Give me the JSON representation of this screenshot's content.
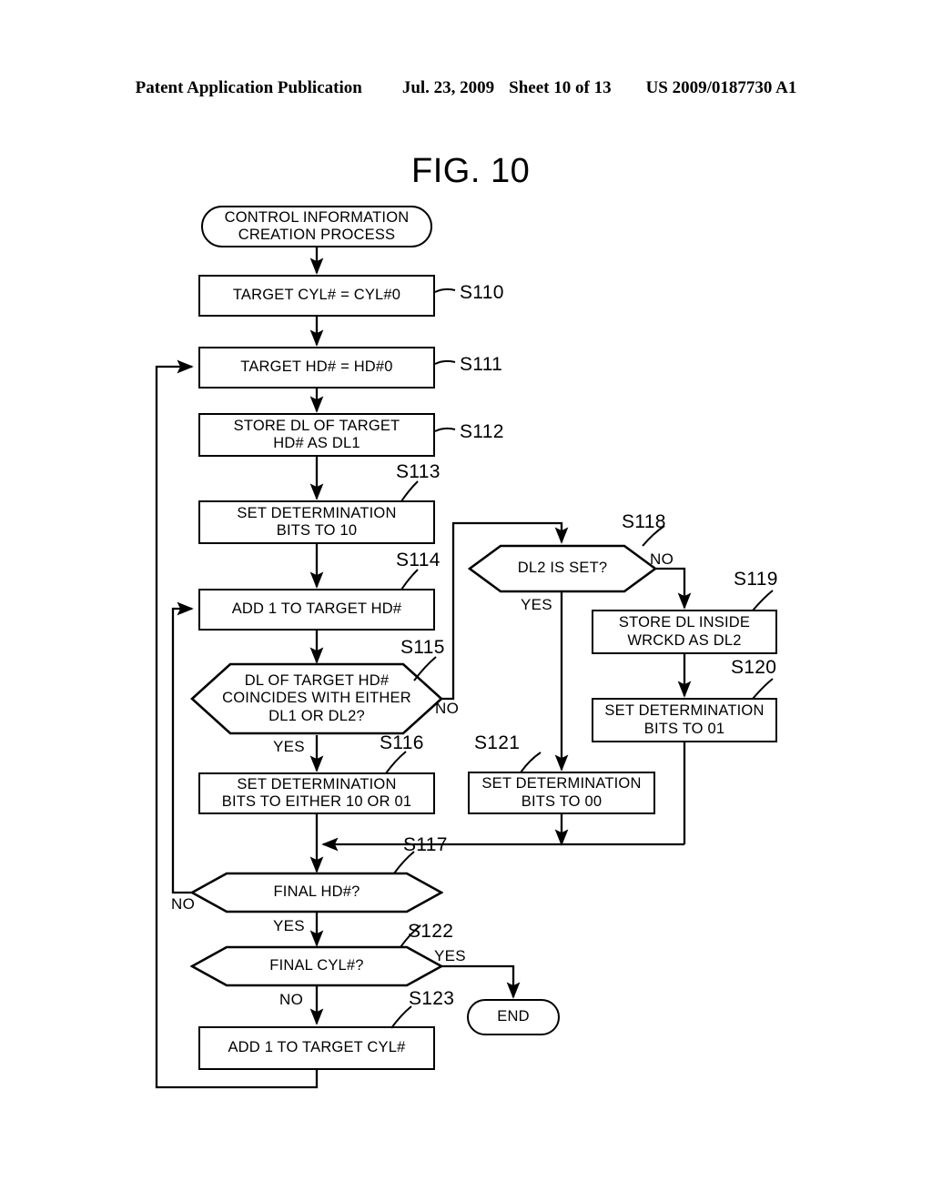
{
  "header": {
    "publication": "Patent Application Publication",
    "date": "Jul. 23, 2009",
    "sheet": "Sheet 10 of 13",
    "docnumber": "US 2009/0187730 A1"
  },
  "figure": {
    "title": "FIG. 10"
  },
  "nodes": {
    "start": "CONTROL INFORMATION\nCREATION PROCESS",
    "s110": "TARGET CYL# = CYL#0",
    "s111": "TARGET HD# = HD#0",
    "s112": "STORE DL OF TARGET\nHD# AS DL1",
    "s113": "SET DETERMINATION\nBITS TO 10",
    "s114": "ADD 1 TO TARGET HD#",
    "s115": "DL OF TARGET HD#\nCOINCIDES WITH EITHER\nDL1 OR DL2?",
    "s116": "SET DETERMINATION\nBITS TO EITHER 10 OR 01",
    "s117": "FINAL HD#?",
    "s118": "DL2 IS SET?",
    "s119": "STORE DL INSIDE\nWRCKD AS DL2",
    "s120": "SET DETERMINATION\nBITS TO 01",
    "s121": "SET DETERMINATION\nBITS TO 00",
    "s122": "FINAL CYL#?",
    "s123": "ADD 1 TO TARGET CYL#",
    "end": "END"
  },
  "steplabels": {
    "s110": "S110",
    "s111": "S111",
    "s112": "S112",
    "s113": "S113",
    "s114": "S114",
    "s115": "S115",
    "s116": "S116",
    "s117": "S117",
    "s118": "S118",
    "s119": "S119",
    "s120": "S120",
    "s121": "S121",
    "s122": "S122",
    "s123": "S123"
  },
  "edgelabels": {
    "s115_yes": "YES",
    "s115_no": "NO",
    "s117_no": "NO",
    "s117_yes": "YES",
    "s118_yes": "YES",
    "s118_no": "NO",
    "s122_yes": "YES",
    "s122_no": "NO"
  },
  "colors": {
    "ink": "#000000",
    "paper": "#ffffff"
  }
}
